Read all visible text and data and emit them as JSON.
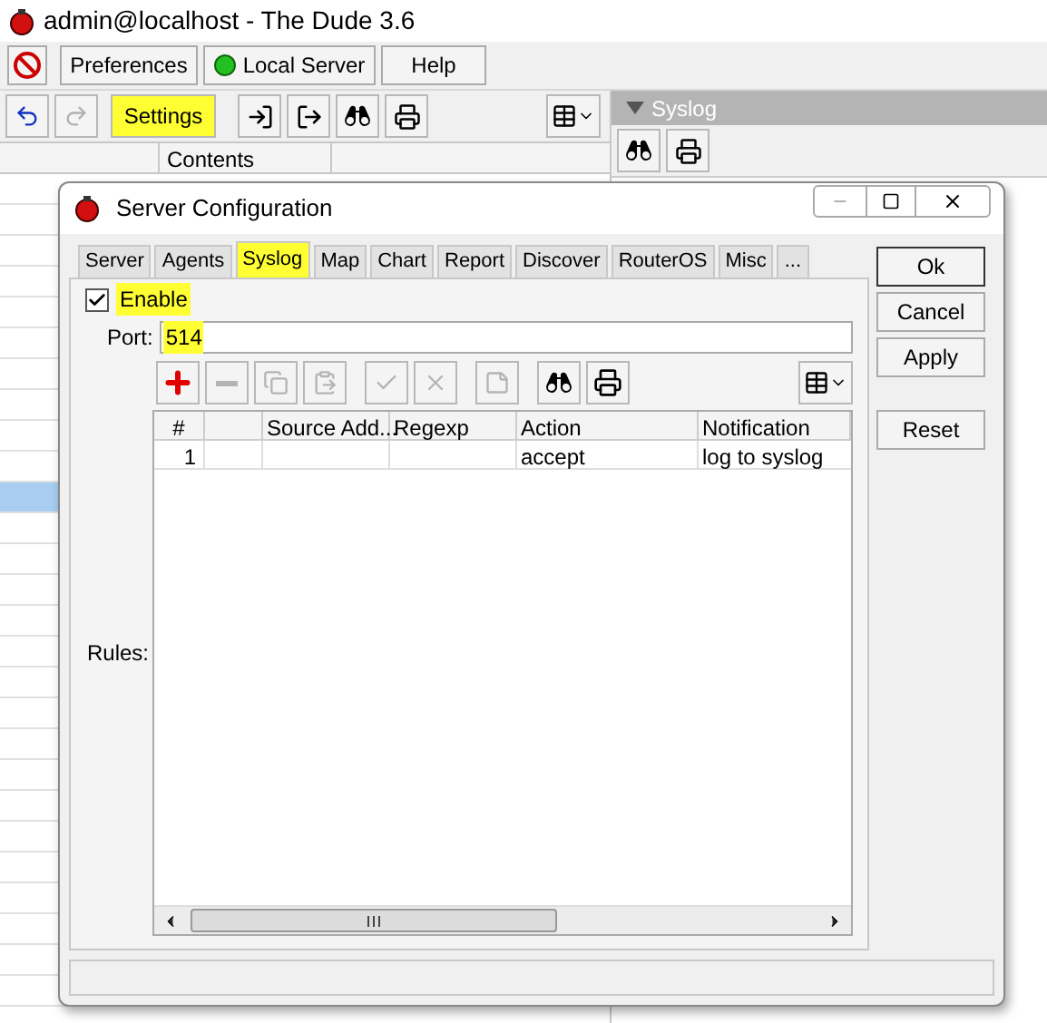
{
  "window": {
    "title": "admin@localhost - The Dude 3.6"
  },
  "menu_buttons": [
    {
      "label": "Preferences",
      "kind": "text"
    },
    {
      "label": "Local Server",
      "kind": "status"
    },
    {
      "label": "Help",
      "kind": "text"
    }
  ],
  "settings_button": {
    "label": "Settings",
    "highlighted": true
  },
  "contents_header": "Contents",
  "left_rows": [
    {
      "selected": false
    },
    {
      "selected": false
    },
    {
      "selected": false
    },
    {
      "selected": false
    },
    {
      "selected": false
    },
    {
      "selected": false
    },
    {
      "selected": false
    },
    {
      "selected": false
    },
    {
      "selected": false
    },
    {
      "selected": false
    },
    {
      "selected": true
    },
    {
      "selected": false
    },
    {
      "selected": false
    },
    {
      "selected": false
    },
    {
      "selected": false
    },
    {
      "selected": false
    },
    {
      "selected": false
    },
    {
      "selected": false
    },
    {
      "selected": false
    },
    {
      "selected": false
    },
    {
      "selected": false
    },
    {
      "selected": false
    },
    {
      "selected": false
    },
    {
      "selected": false
    },
    {
      "selected": false
    },
    {
      "selected": false
    },
    {
      "selected": false
    }
  ],
  "syslog_panel": {
    "title": "Syslog"
  },
  "dialog": {
    "title": "Server Configuration",
    "tabs": [
      {
        "label": "Server",
        "selected": false,
        "highlighted": false
      },
      {
        "label": "Agents",
        "selected": false,
        "highlighted": false
      },
      {
        "label": "Syslog",
        "selected": true,
        "highlighted": true
      },
      {
        "label": "Map",
        "selected": false,
        "highlighted": false
      },
      {
        "label": "Chart",
        "selected": false,
        "highlighted": false
      },
      {
        "label": "Report",
        "selected": false,
        "highlighted": false
      },
      {
        "label": "Discover",
        "selected": false,
        "highlighted": false
      },
      {
        "label": "RouterOS",
        "selected": false,
        "highlighted": false
      },
      {
        "label": "Misc",
        "selected": false,
        "highlighted": false
      },
      {
        "label": "...",
        "selected": false,
        "highlighted": false
      }
    ],
    "enable": {
      "label": "Enable",
      "checked": true,
      "highlighted": true
    },
    "port": {
      "label": "Port:",
      "value": "514",
      "highlighted": true
    },
    "rules_label": "Rules:",
    "rule_tools": [
      {
        "kind": "add",
        "disabled": false
      },
      {
        "kind": "remove",
        "disabled": true
      },
      {
        "kind": "copy",
        "disabled": true
      },
      {
        "kind": "paste",
        "disabled": true
      },
      {
        "kind": "enable",
        "disabled": true
      },
      {
        "kind": "disable",
        "disabled": true
      },
      {
        "kind": "comment",
        "disabled": true
      },
      {
        "kind": "find",
        "disabled": false
      },
      {
        "kind": "print",
        "disabled": false
      }
    ],
    "table": {
      "columns": [
        {
          "label": "#"
        },
        {},
        {
          "label": "Source Add..."
        },
        {
          "label": "Regexp"
        },
        {
          "label": "Action"
        },
        {
          "label": "Notification"
        }
      ],
      "rows": [
        {
          "number": "1",
          "action": "accept",
          "notification": "log to syslog"
        }
      ]
    },
    "buttons": [
      {
        "label": "Ok",
        "default": true
      },
      {
        "label": "Cancel",
        "default": false
      },
      {
        "label": "Apply",
        "default": false
      },
      {
        "label": "Reset",
        "default": false
      }
    ]
  }
}
